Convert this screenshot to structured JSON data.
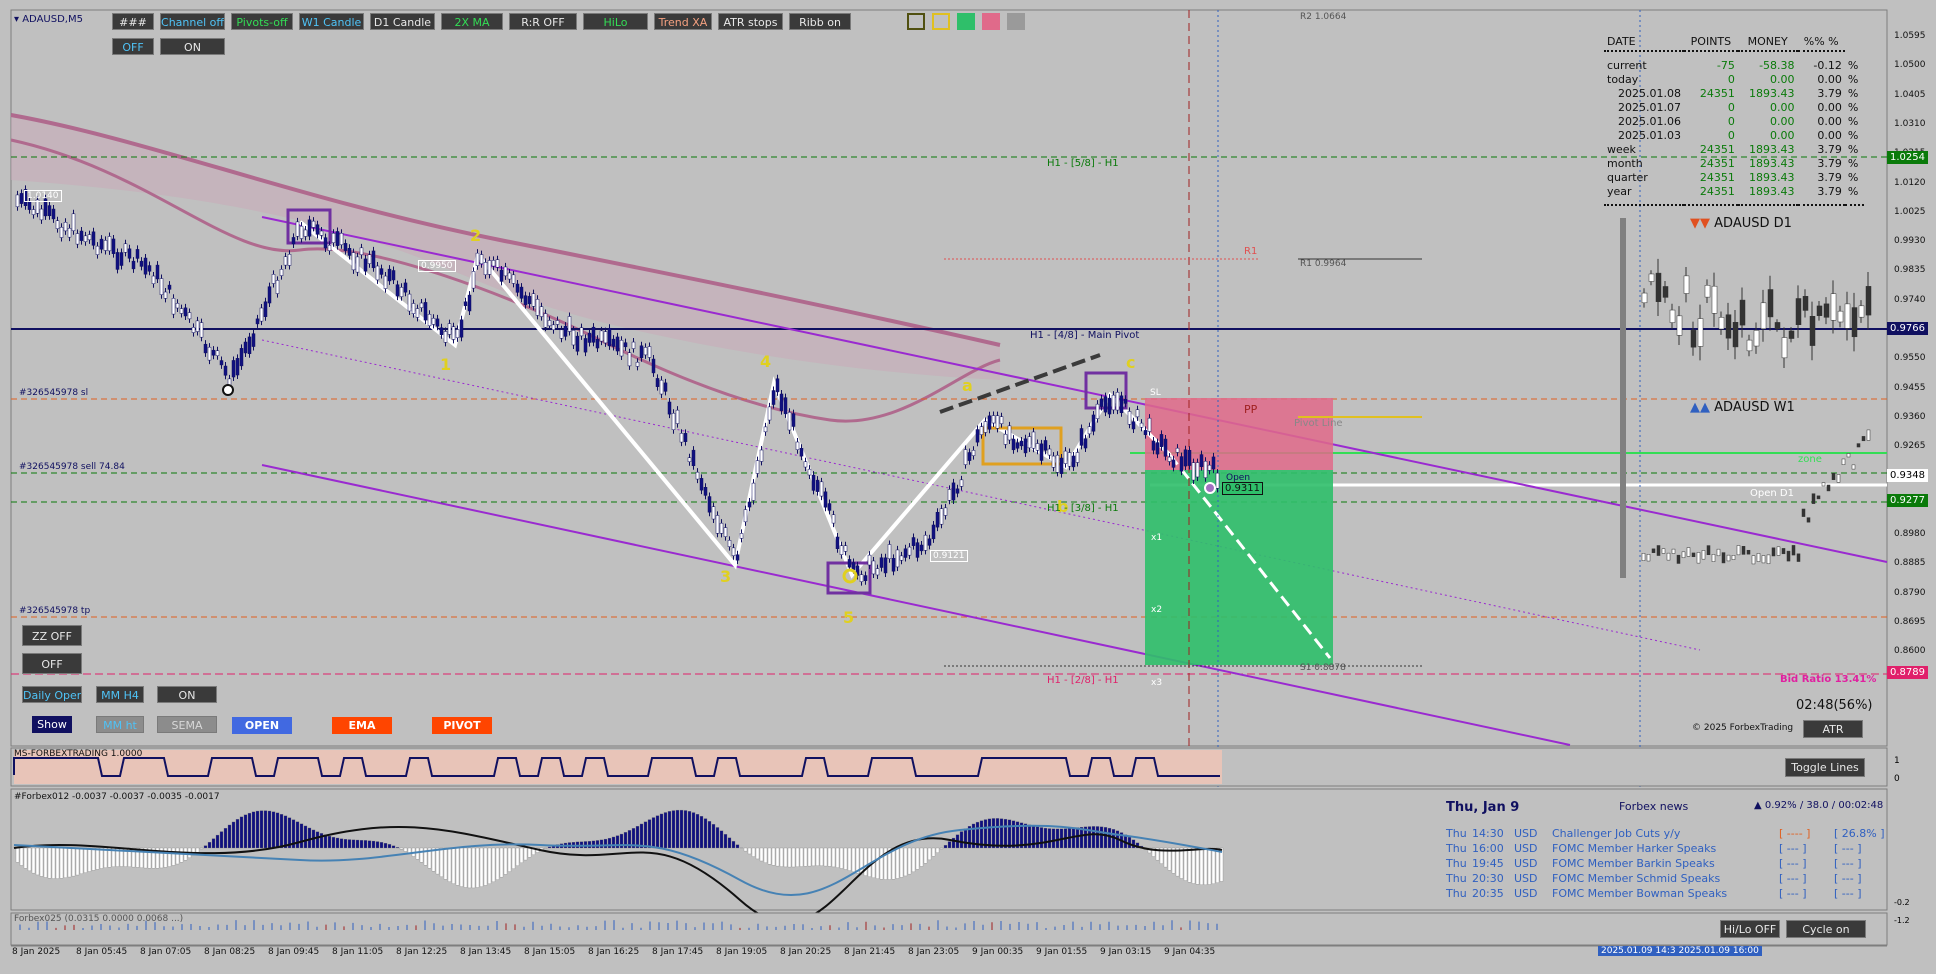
{
  "symbol_title": "ADAUSD,M5",
  "toolbar": {
    "row1": [
      "###",
      "Channel off",
      "Pivots-off",
      "W1 Candle",
      "D1 Candle",
      "2X MA",
      "R:R OFF",
      "HiLo",
      "Trend XA",
      "ATR stops",
      "Ribb on"
    ],
    "row2": [
      "OFF",
      "ON"
    ]
  },
  "left_panel": {
    "zz": "ZZ OFF",
    "off": "OFF",
    "daily_open": "Daily Open",
    "mm_h4": "MM H4",
    "on": "ON",
    "show": "Show",
    "mm_ht": "MM ht",
    "sema": "SEMA",
    "open": "OPEN",
    "ema": "EMA",
    "pivot": "PIVOT"
  },
  "stats": {
    "headers": [
      "DATE",
      "POINTS",
      "MONEY",
      "%%  %"
    ],
    "rows": [
      {
        "label": "current",
        "points": "-75",
        "money": "-58.38",
        "pct": "-0.12",
        "unit": "%"
      },
      {
        "label": "today",
        "points": "0",
        "money": "0.00",
        "pct": "0.00",
        "unit": "%"
      },
      {
        "label": "2025.01.08",
        "points": "24351",
        "money": "1893.43",
        "pct": "3.79",
        "unit": "%"
      },
      {
        "label": "2025.01.07",
        "points": "0",
        "money": "0.00",
        "pct": "0.00",
        "unit": "%"
      },
      {
        "label": "2025.01.06",
        "points": "0",
        "money": "0.00",
        "pct": "0.00",
        "unit": "%"
      },
      {
        "label": "2025.01.03",
        "points": "0",
        "money": "0.00",
        "pct": "0.00",
        "unit": "%"
      },
      {
        "label": "week",
        "points": "24351",
        "money": "1893.43",
        "pct": "3.79",
        "unit": "%"
      },
      {
        "label": "month",
        "points": "24351",
        "money": "1893.43",
        "pct": "3.79",
        "unit": "%"
      },
      {
        "label": "quarter",
        "points": "24351",
        "money": "1893.43",
        "pct": "3.79",
        "unit": "%"
      },
      {
        "label": "year",
        "points": "24351",
        "money": "1893.43",
        "pct": "3.79",
        "unit": "%"
      }
    ]
  },
  "mini_charts": {
    "d1": "ADAUSD  D1",
    "w1": "ADAUSD  W1",
    "zone": "zone",
    "open_d1": "Open D1"
  },
  "chart_labels": {
    "r2": "R2 1.0664",
    "r1_small": "R1 0.9964",
    "r1": "R1",
    "pp": "PP",
    "pivot_line": "Pivot Line",
    "s1": "S1 0.8878",
    "h1_58": "H1 - [5/8] - H1",
    "h1_48": "H1 - [4/8] - Main Pivot",
    "h1_38": "H1 - [3/8] - H1",
    "h1_28": "H1 - [2/8] - H1",
    "order_sl": "#326545978 sl",
    "order_sell": "#326545978 sell 74.84",
    "order_tp": "#326545978 tp",
    "price_hi": "1.0140",
    "price_mid": "0.9950",
    "price_low": "0.9121",
    "price_cur": "0.9311",
    "sl": "SL",
    "open_tag": "Open",
    "x1": "x1",
    "x2": "x2",
    "x3": "x3",
    "wave": [
      "1",
      "2",
      "3",
      "4",
      "5",
      "a",
      "b",
      "c"
    ],
    "bid_ratio": "Bid Ratio 13.41%",
    "copyright": "© 2025 ForbexTrading",
    "timer": "02:48(56%)",
    "atr": "ATR"
  },
  "price_scale": [
    "1.0595",
    "1.0500",
    "1.0405",
    "1.0310",
    "1.0215",
    "1.0120",
    "1.0025",
    "0.9930",
    "0.9835",
    "0.9740",
    "0.9645",
    "0.9550",
    "0.9455",
    "0.9360",
    "0.9265",
    "0.9170",
    "0.9075",
    "0.8980",
    "0.8885",
    "0.8790",
    "0.8695",
    "0.8600"
  ],
  "price_boxes": [
    {
      "text": "1.0254",
      "bg": "#0a7a0a",
      "fg": "#ffffff"
    },
    {
      "text": "0.9766",
      "bg": "#101060",
      "fg": "#ffffff"
    },
    {
      "text": "0.9348",
      "bg": "#ffffff",
      "fg": "#000000"
    },
    {
      "text": "0.9277",
      "bg": "#0a7a0a",
      "fg": "#ffffff"
    },
    {
      "text": "0.8789",
      "bg": "#e0206a",
      "fg": "#ffffff"
    }
  ],
  "sub1": {
    "title": "MS-FORBEXTRADING 1.0000",
    "toggle": "Toggle Lines",
    "scale": [
      "1",
      "0"
    ]
  },
  "sub2": {
    "title": "#Forbex012 -0.0037 -0.0037 -0.0035 -0.0017"
  },
  "sub3": {
    "title": "Forbex025 (0.0315 0.0000 0.0068 ...)",
    "scale": [
      "-1.2",
      "-0.2"
    ],
    "hilo": "Hi/Lo OFF",
    "cycle": "Cycle on"
  },
  "news": {
    "date": "Thu, Jan 9",
    "title": "Forbex news",
    "stats": "▲ 0.92% / 38.0 / 00:02:48",
    "rows": [
      {
        "day": "Thu",
        "time": "14:30",
        "ccy": "USD",
        "event": "Challenger Job Cuts y/y",
        "f": "[ ---- ]",
        "p": "[ 26.8% ]"
      },
      {
        "day": "Thu",
        "time": "16:00",
        "ccy": "USD",
        "event": "FOMC Member Harker Speaks",
        "f": "[ --- ]",
        "p": "[ --- ]"
      },
      {
        "day": "Thu",
        "time": "19:45",
        "ccy": "USD",
        "event": "FOMC Member Barkin Speaks",
        "f": "[ --- ]",
        "p": "[ --- ]"
      },
      {
        "day": "Thu",
        "time": "20:30",
        "ccy": "USD",
        "event": "FOMC Member Schmid Speaks",
        "f": "[ --- ]",
        "p": "[ --- ]"
      },
      {
        "day": "Thu",
        "time": "20:35",
        "ccy": "USD",
        "event": "FOMC Member Bowman Speaks",
        "f": "[ --- ]",
        "p": "[ --- ]"
      }
    ],
    "range": "2025.01.09 14:3  2025.01.09 16:00"
  },
  "time_axis": [
    "8 Jan 2025",
    "8 Jan 05:45",
    "8 Jan 07:05",
    "8 Jan 08:25",
    "8 Jan 09:45",
    "8 Jan 11:05",
    "8 Jan 12:25",
    "8 Jan 13:45",
    "8 Jan 15:05",
    "8 Jan 16:25",
    "8 Jan 17:45",
    "8 Jan 19:05",
    "8 Jan 20:25",
    "8 Jan 21:45",
    "8 Jan 23:05",
    "9 Jan 00:35",
    "9 Jan 01:55",
    "9 Jan 03:15",
    "9 Jan 04:35"
  ],
  "colors": {
    "accent_navy": "#101060",
    "purple_channel": "#9a2ad0",
    "ma_band": "#b06a8e",
    "green_zone": "#2fbf6a",
    "red_zone": "#e06a8a"
  }
}
